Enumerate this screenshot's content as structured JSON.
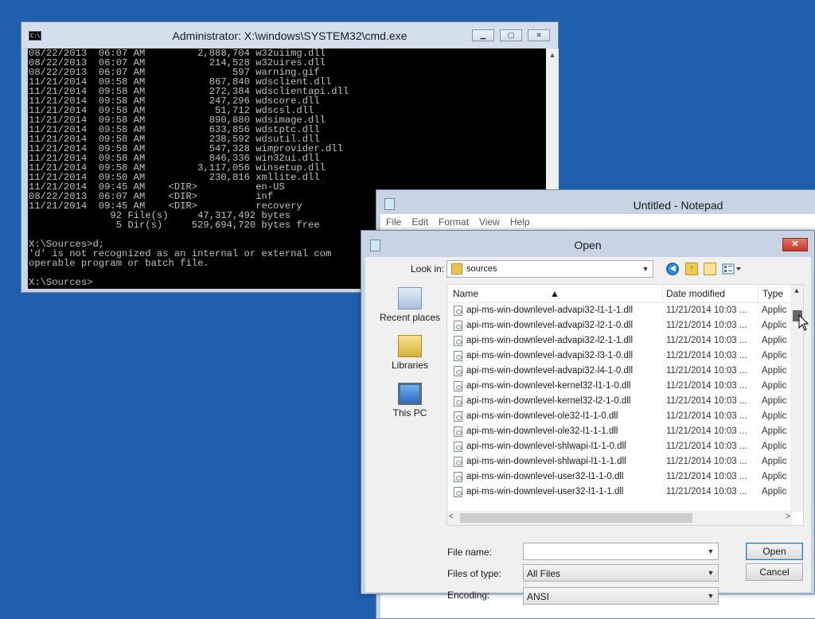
{
  "cmd": {
    "title": "Administrator: X:\\windows\\SYSTEM32\\cmd.exe",
    "icon_text": "C:\\",
    "output": "08/22/2013  06:07 AM         2,888,704 w32uiimg.dll\n08/22/2013  06:07 AM           214,528 w32uires.dll\n08/22/2013  06:07 AM               597 warning.gif\n11/21/2014  09:58 AM           867,840 wdsclient.dll\n11/21/2014  09:58 AM           272,384 wdsclientapi.dll\n11/21/2014  09:58 AM           247,296 wdscore.dll\n11/21/2014  09:58 AM            51,712 wdscsl.dll\n11/21/2014  09:58 AM           890,880 wdsimage.dll\n11/21/2014  09:58 AM           633,856 wdstptc.dll\n11/21/2014  09:58 AM           238,592 wdsutil.dll\n11/21/2014  09:58 AM           547,328 wimprovider.dll\n11/21/2014  09:58 AM           846,336 win32ui.dll\n11/21/2014  09:58 AM         3,117,056 winsetup.dll\n11/21/2014  09:50 AM           230,816 xmllite.dll\n11/21/2014  09:45 AM    <DIR>          en-US\n08/22/2013  06:07 AM    <DIR>          inf\n11/21/2014  09:45 AM    <DIR>          recovery\n              92 File(s)     47,317,492 bytes\n               5 Dir(s)     529,694,720 bytes free\n\nX:\\Sources>d;\n'd' is not recognized as an internal or external com\noperable program or batch file.\n\nX:\\Sources>"
  },
  "notepad": {
    "title": "Untitled - Notepad",
    "menu": [
      "File",
      "Edit",
      "Format",
      "View",
      "Help"
    ]
  },
  "open_dialog": {
    "title": "Open",
    "look_in_label": "Look in:",
    "look_in_value": "sources",
    "places": [
      {
        "label": "Recent places",
        "icon": "recent-places-icon"
      },
      {
        "label": "Libraries",
        "icon": "libraries-icon"
      },
      {
        "label": "This PC",
        "icon": "this-pc-icon"
      }
    ],
    "columns": {
      "name": "Name",
      "date": "Date modified",
      "type": "Type"
    },
    "files": [
      {
        "name": "api-ms-win-downlevel-advapi32-l1-1-1.dll",
        "date": "11/21/2014 10:03 ...",
        "type": "Applic"
      },
      {
        "name": "api-ms-win-downlevel-advapi32-l2-1-0.dll",
        "date": "11/21/2014 10:03 ...",
        "type": "Applic"
      },
      {
        "name": "api-ms-win-downlevel-advapi32-l2-1-1.dll",
        "date": "11/21/2014 10:03 ...",
        "type": "Applic"
      },
      {
        "name": "api-ms-win-downlevel-advapi32-l3-1-0.dll",
        "date": "11/21/2014 10:03 ...",
        "type": "Applic"
      },
      {
        "name": "api-ms-win-downlevel-advapi32-l4-1-0.dll",
        "date": "11/21/2014 10:03 ...",
        "type": "Applic"
      },
      {
        "name": "api-ms-win-downlevel-kernel32-l1-1-0.dll",
        "date": "11/21/2014 10:03 ...",
        "type": "Applic"
      },
      {
        "name": "api-ms-win-downlevel-kernel32-l2-1-0.dll",
        "date": "11/21/2014 10:03 ...",
        "type": "Applic"
      },
      {
        "name": "api-ms-win-downlevel-ole32-l1-1-0.dll",
        "date": "11/21/2014 10:03 ...",
        "type": "Applic"
      },
      {
        "name": "api-ms-win-downlevel-ole32-l1-1-1.dll",
        "date": "11/21/2014 10:03 ...",
        "type": "Applic"
      },
      {
        "name": "api-ms-win-downlevel-shlwapi-l1-1-0.dll",
        "date": "11/21/2014 10:03 ...",
        "type": "Applic"
      },
      {
        "name": "api-ms-win-downlevel-shlwapi-l1-1-1.dll",
        "date": "11/21/2014 10:03 ...",
        "type": "Applic"
      },
      {
        "name": "api-ms-win-downlevel-user32-l1-1-0.dll",
        "date": "11/21/2014 10:03 ...",
        "type": "Applic"
      },
      {
        "name": "api-ms-win-downlevel-user32-l1-1-1.dll",
        "date": "11/21/2014 10:03 ...",
        "type": "Applic"
      }
    ],
    "file_name_label": "File name:",
    "file_name_value": "",
    "files_of_type_label": "Files of type:",
    "files_of_type_value": "All Files",
    "encoding_label": "Encoding:",
    "encoding_value": "ANSI",
    "open_button": "Open",
    "cancel_button": "Cancel"
  },
  "colors": {
    "desktop": "#1f5fae",
    "console_bg": "#000000",
    "console_text": "#c0c0c0",
    "close_button": "#c63a2a"
  }
}
